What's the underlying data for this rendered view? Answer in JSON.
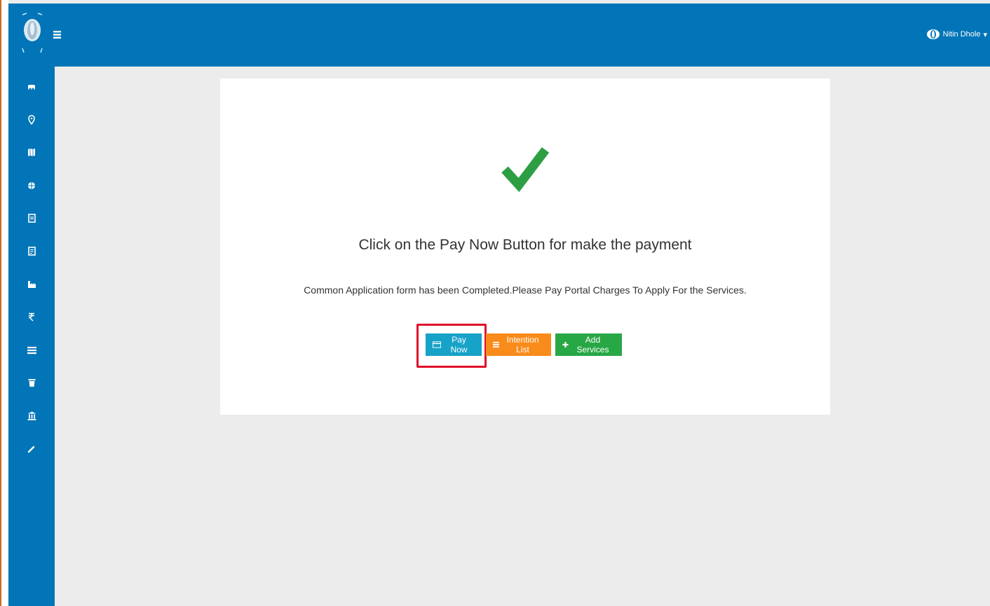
{
  "header": {
    "menu_icon": "hamburger-icon",
    "user_name": "Nitin Dhole",
    "user_caret": "▾"
  },
  "sidebar": {
    "items": [
      {
        "icon": "dashboard-icon"
      },
      {
        "icon": "location-pin-icon"
      },
      {
        "icon": "map-icon"
      },
      {
        "icon": "globe-icon"
      },
      {
        "icon": "document-icon"
      },
      {
        "icon": "document-alt-icon"
      },
      {
        "icon": "industry-icon"
      },
      {
        "icon": "rupee-icon"
      },
      {
        "icon": "list-icon"
      },
      {
        "icon": "trash-icon"
      },
      {
        "icon": "bank-icon"
      },
      {
        "icon": "pencil-icon"
      }
    ]
  },
  "main": {
    "headline": "Click on the Pay Now Button for make the payment",
    "message": "Common Application form has been Completed.Please Pay Portal Charges To Apply For the Services.",
    "buttons": {
      "pay_now": "Pay Now",
      "intention_list": "Intention List",
      "add_services": "Add Services"
    }
  },
  "colors": {
    "brand_blue": "#0275b8",
    "pay_now": "#17a2c8",
    "intention_list": "#f98b1a",
    "add_services": "#28a745",
    "check": "#2e9e44",
    "highlight": "#e0102a"
  }
}
